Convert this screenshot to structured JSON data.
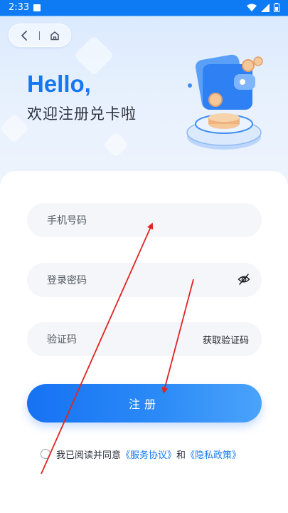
{
  "status_bar": {
    "time": "2:33"
  },
  "header": {
    "greeting": "Hello,",
    "subtitle": "欢迎注册兑卡啦"
  },
  "form": {
    "phone_placeholder": "手机号码",
    "password_placeholder": "登录密码",
    "code_placeholder": "验证码",
    "get_code_label": "获取验证码",
    "submit_label": "注册"
  },
  "agreement": {
    "prefix": "我已阅读并同意",
    "service_link": "《服务协议》",
    "joiner": "和",
    "privacy_link": "《隐私政策》"
  },
  "colors": {
    "accent": "#1677f3",
    "status_bar": "#0e7bf4",
    "annotation": "#e02424"
  },
  "icons": [
    "back-icon",
    "home-icon",
    "eye-off-icon",
    "wifi-icon",
    "signal-icon",
    "battery-icon"
  ]
}
